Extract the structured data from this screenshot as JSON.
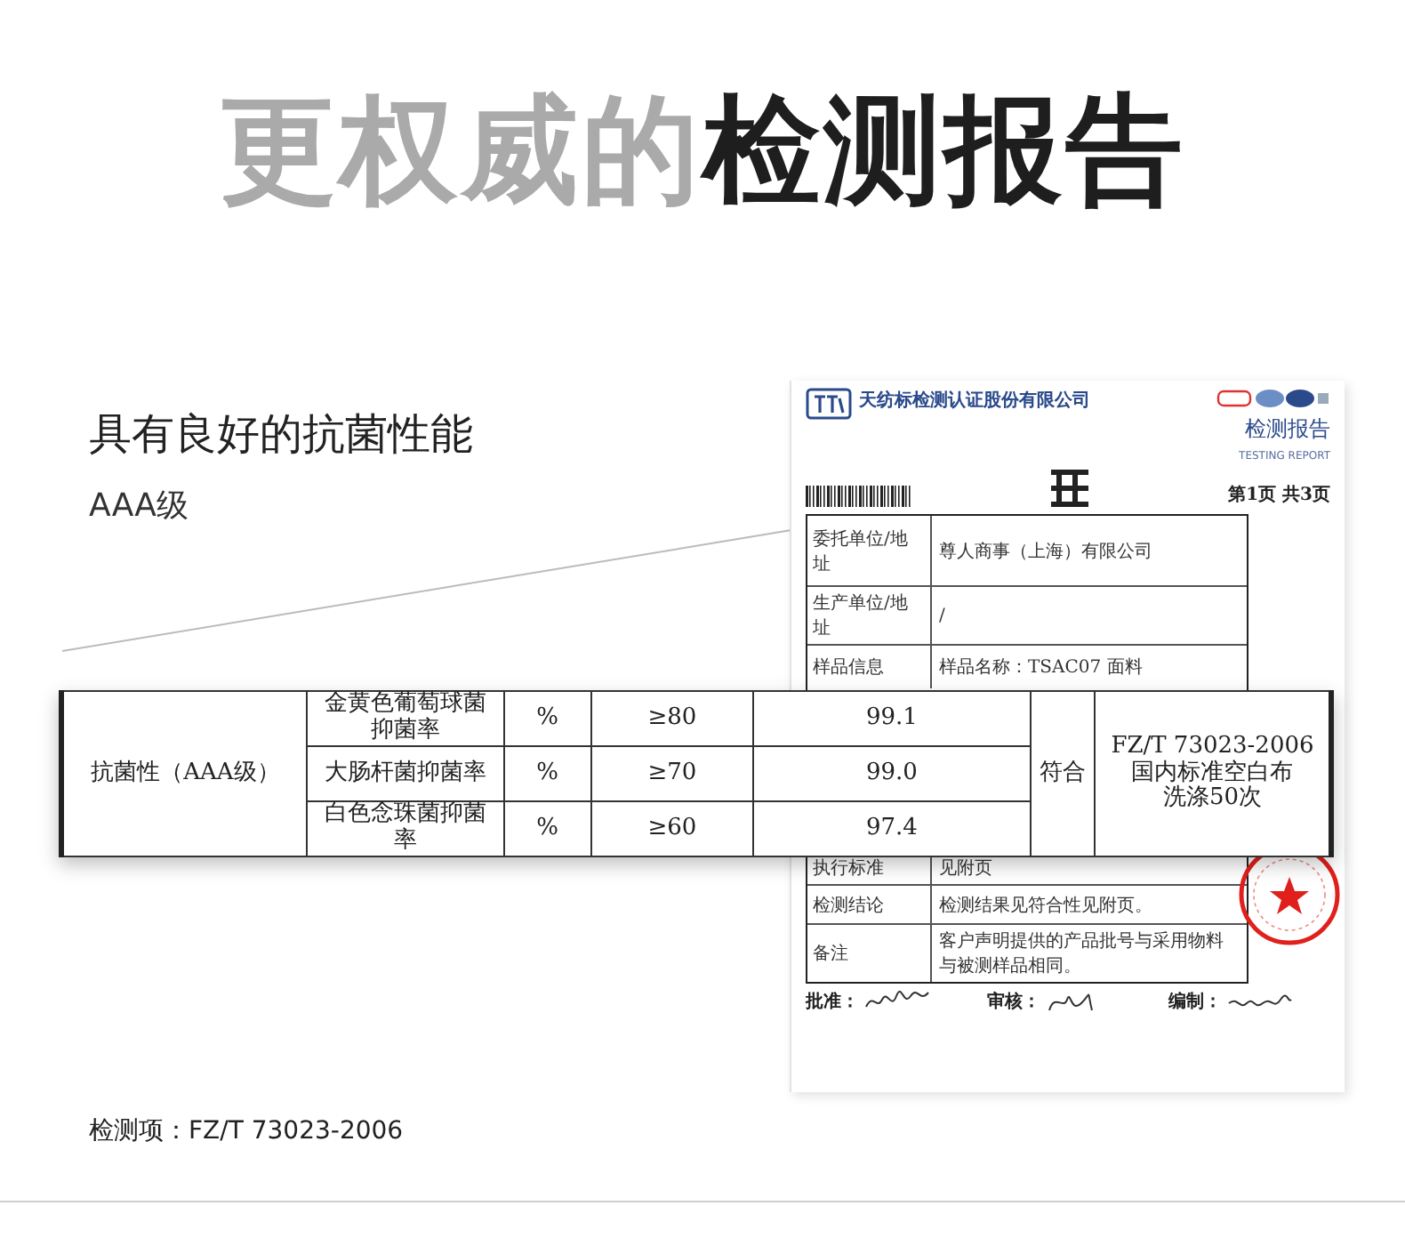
{
  "heading": {
    "light": "更权威的",
    "dark": "检测报告"
  },
  "subtitle": "具有良好的抗菌性能",
  "grade": "AAA级",
  "report": {
    "company": "天纺标检测认证股份有限公司",
    "title": "检测报告",
    "title_en": "TESTING REPORT",
    "page": "第1页 共3页",
    "top_rows": [
      {
        "label": "委托单位/地址",
        "value": "尊人商事（上海）有限公司"
      },
      {
        "label": "生产单位/地址",
        "value": "/"
      },
      {
        "label": "样品信息",
        "value": "样品名称：TSAC07 面料"
      }
    ],
    "bottom_rows": [
      {
        "label": "执行标准",
        "value": "见附页"
      },
      {
        "label": "检测结论",
        "value": "检测结果见符合性见附页。"
      },
      {
        "label": "备注",
        "value": "客户声明提供的产品批号与采用物料与被测样品相同。"
      }
    ],
    "signatures": [
      "批准：",
      "审核：",
      "编制："
    ]
  },
  "result_table": {
    "item": "抗菌性（AAA级）",
    "verdict": "符合",
    "standard": [
      "FZ/T 73023-2006",
      "国内标准空白布",
      "洗涤50次"
    ],
    "rows": [
      {
        "name": "金黄色葡萄球菌抑菌率",
        "unit": "%",
        "requirement": "≥80",
        "result": "99.1"
      },
      {
        "name": "大肠杆菌抑菌率",
        "unit": "%",
        "requirement": "≥70",
        "result": "99.0"
      },
      {
        "name": "白色念珠菌抑菌率",
        "unit": "%",
        "requirement": "≥60",
        "result": "97.4"
      }
    ]
  },
  "footnote": "检测项：FZ/T 73023-2006"
}
